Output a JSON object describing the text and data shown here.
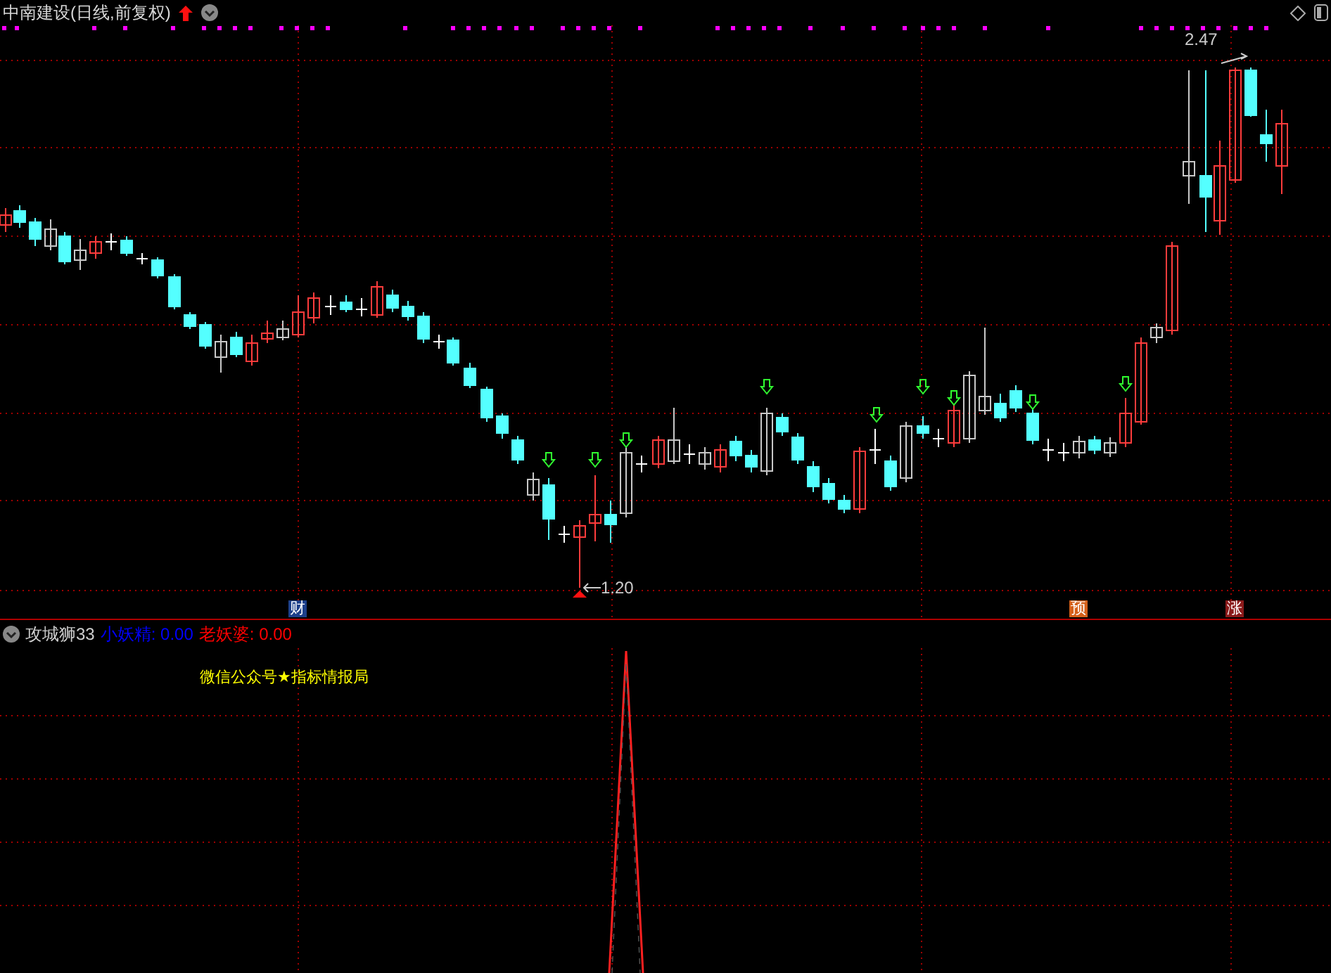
{
  "title": "中南建设(日线,前复权)",
  "main_chart": {
    "high_label": "2.47",
    "low_label": "1.20",
    "event_markers": [
      {
        "label": "财",
        "color": "#1c3f8a"
      },
      {
        "label": "预",
        "color": "#d4601a"
      },
      {
        "label": "涨",
        "color": "#8b1a1a"
      }
    ]
  },
  "indicator": {
    "name": "攻城狮33",
    "values": [
      {
        "label": "小妖精:",
        "value": "0.00",
        "color": "#0000ff"
      },
      {
        "label": "老妖婆:",
        "value": "0.00",
        "color": "#ff0000"
      }
    ],
    "note": "微信公众号★指标情报局"
  }
}
